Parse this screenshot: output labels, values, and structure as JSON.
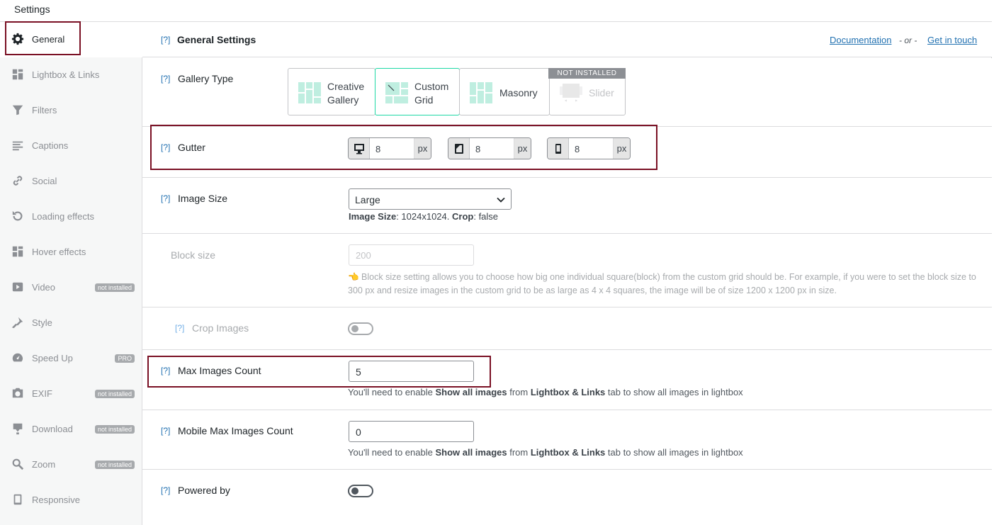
{
  "topbar": {
    "title": "Settings"
  },
  "sidebar": {
    "items": [
      {
        "label": "General",
        "icon": "gear-icon",
        "badge": ""
      },
      {
        "label": "Lightbox & Links",
        "icon": "lightbox-icon",
        "badge": ""
      },
      {
        "label": "Filters",
        "icon": "filter-icon",
        "badge": ""
      },
      {
        "label": "Captions",
        "icon": "captions-icon",
        "badge": ""
      },
      {
        "label": "Social",
        "icon": "link-icon",
        "badge": ""
      },
      {
        "label": "Loading effects",
        "icon": "refresh-icon",
        "badge": ""
      },
      {
        "label": "Hover effects",
        "icon": "hover-icon",
        "badge": ""
      },
      {
        "label": "Video",
        "icon": "video-icon",
        "badge": "not installed"
      },
      {
        "label": "Style",
        "icon": "brush-icon",
        "badge": ""
      },
      {
        "label": "Speed Up",
        "icon": "dashboard-icon",
        "badge": "PRO"
      },
      {
        "label": "EXIF",
        "icon": "camera-icon",
        "badge": "not installed"
      },
      {
        "label": "Download",
        "icon": "download-icon",
        "badge": "not installed"
      },
      {
        "label": "Zoom",
        "icon": "zoom-icon",
        "badge": "not installed"
      },
      {
        "label": "Responsive",
        "icon": "tablet-icon",
        "badge": ""
      }
    ]
  },
  "header": {
    "help": "[?]",
    "title": "General Settings",
    "documentation": "Documentation",
    "or": "- or -",
    "get_in_touch": "Get in touch"
  },
  "gallery_type": {
    "help": "[?]",
    "label": "Gallery Type",
    "options": [
      {
        "line1": "Creative",
        "line2": "Gallery"
      },
      {
        "line1": "Custom",
        "line2": "Grid"
      },
      {
        "line1": "Masonry",
        "line2": ""
      },
      {
        "line1": "Slider",
        "line2": ""
      }
    ],
    "selected": "Custom Grid",
    "not_installed": "NOT INSTALLED"
  },
  "gutter": {
    "help": "[?]",
    "label": "Gutter",
    "desktop": "8",
    "tablet": "8",
    "mobile": "8",
    "unit": "px"
  },
  "image_size": {
    "help": "[?]",
    "label": "Image Size",
    "value": "Large",
    "info_label1": "Image Size",
    "info_value1": ": 1024x1024. ",
    "info_label2": "Crop",
    "info_value2": ": false"
  },
  "block_size": {
    "label": "Block size",
    "placeholder": "200",
    "help_text": "👈 Block size setting allows you to choose how big one individual square(block) from the custom grid should be. For example, if you were to set the block size to 300 px and resize images in the custom grid to be as large as 4 x 4 squares, the image will be of size 1200 x 1200 px in size."
  },
  "crop_images": {
    "help": "[?]",
    "label": "Crop Images",
    "enabled": false
  },
  "max_images": {
    "help": "[?]",
    "label": "Max Images Count",
    "value": "5",
    "hint_pre": "You'll need to enable ",
    "hint_b1": "Show all images",
    "hint_mid": " from ",
    "hint_b2": "Lightbox & Links",
    "hint_post": " tab to show all images in lightbox"
  },
  "mobile_max_images": {
    "help": "[?]",
    "label": "Mobile Max Images Count",
    "value": "0",
    "hint_pre": "You'll need to enable ",
    "hint_b1": "Show all images",
    "hint_mid": " from ",
    "hint_b2": "Lightbox & Links",
    "hint_post": " tab to show all images in lightbox"
  },
  "powered_by": {
    "help": "[?]",
    "label": "Powered by",
    "enabled": false
  },
  "colors": {
    "accent": "#2271b1",
    "highlight": "#7a1024",
    "selected_border": "#1ed8a5",
    "gallery_icon": "#bfeee0"
  }
}
